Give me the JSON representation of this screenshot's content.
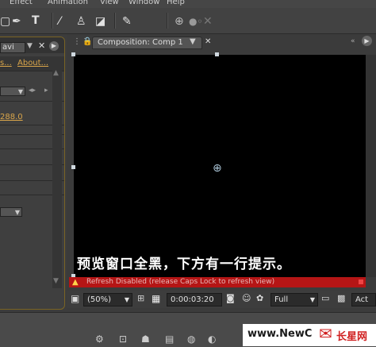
{
  "menu": {
    "items": [
      "Effect",
      "Animation",
      "View",
      "Window",
      "Help"
    ]
  },
  "toolbar": {
    "text_tool_label": "T"
  },
  "left_panel": {
    "dropdown_value": "avi",
    "link_a": "s...",
    "link_b": "About...",
    "value_text": "288.0"
  },
  "composition": {
    "tab_label": "Composition: Comp 1",
    "caption": "预览窗口全黑，下方有一行提示。",
    "warning_text": "Refresh Disabled (release Caps Lock to refresh view)",
    "zoom": "(50%)",
    "timecode": "0:00:03:20",
    "resolution": "Full",
    "active_camera": "Act"
  },
  "watermark": {
    "text": "www.NewC",
    "suffix": "长星网"
  },
  "colors": {
    "accent": "#d9a54a",
    "warning": "#b51515",
    "viewer_bg": "#000000"
  }
}
